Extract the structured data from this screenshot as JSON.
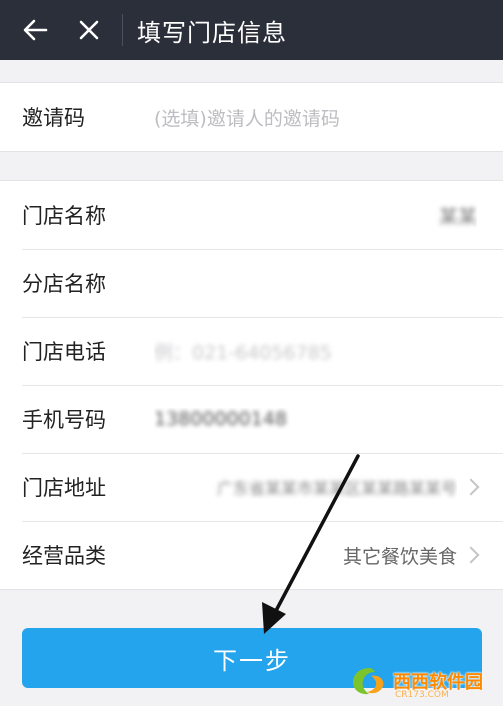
{
  "topbar": {
    "title": "填写门店信息",
    "back_icon": "back-arrow-icon",
    "close_icon": "close-icon"
  },
  "invite": {
    "label": "邀请码",
    "placeholder": "(选填)邀请人的邀请码"
  },
  "form": {
    "store_name": {
      "label": "门店名称",
      "value": "某某"
    },
    "branch_name": {
      "label": "分店名称",
      "value": ""
    },
    "store_phone": {
      "label": "门店电话",
      "value": "例：021-64056785"
    },
    "mobile": {
      "label": "手机号码",
      "value": "13800000148"
    },
    "address": {
      "label": "门店地址",
      "value": "广东省某某市某某区某某路某某号"
    },
    "category": {
      "label": "经营品类",
      "value": "其它餐饮美食"
    }
  },
  "cta": {
    "label": "下一步"
  },
  "watermark": {
    "brand": "西西软件园",
    "sub": "CR173.COM"
  },
  "colors": {
    "accent": "#23a4ec",
    "topbar": "#2b2f3a",
    "background": "#f2f2f4"
  }
}
